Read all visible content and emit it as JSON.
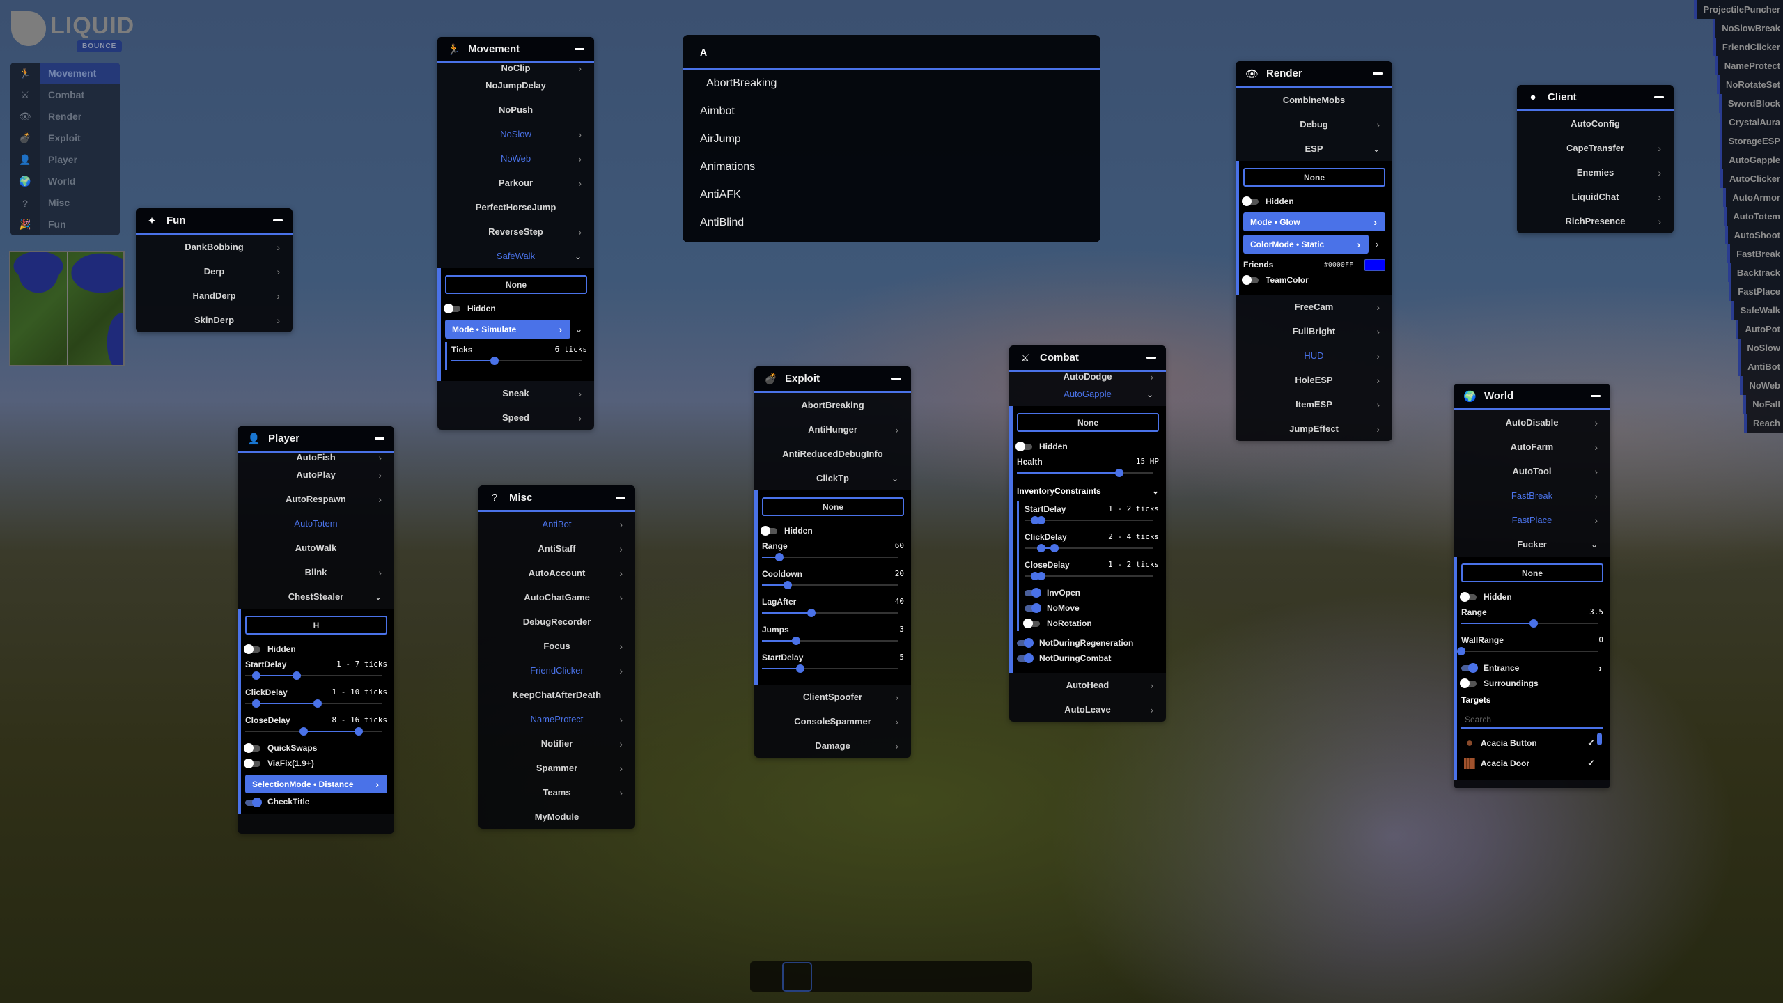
{
  "logo": {
    "word": "LIQUID",
    "badge": "BOUNCE"
  },
  "categories": [
    {
      "label": "Movement",
      "icon": "running-icon",
      "glyph": "🏃",
      "active": true
    },
    {
      "label": "Combat",
      "icon": "crossed-swords-icon",
      "glyph": "⚔"
    },
    {
      "label": "Render",
      "icon": "eye-icon",
      "glyph": "👁"
    },
    {
      "label": "Exploit",
      "icon": "bomb-icon",
      "glyph": "💣"
    },
    {
      "label": "Player",
      "icon": "user-icon",
      "glyph": "👤"
    },
    {
      "label": "World",
      "icon": "globe-icon",
      "glyph": "🌍"
    },
    {
      "label": "Misc",
      "icon": "question-icon",
      "glyph": "?"
    },
    {
      "label": "Fun",
      "icon": "party-popper-icon",
      "glyph": "🎉"
    }
  ],
  "search_popup": {
    "query": "A",
    "results": [
      "AbortBreaking",
      "Aimbot",
      "AirJump",
      "Animations",
      "AntiAFK",
      "AntiBlind"
    ]
  },
  "panels": {
    "fun": {
      "title": "Fun",
      "modules": [
        {
          "name": "DankBobbing",
          "chevron": true
        },
        {
          "name": "Derp",
          "chevron": true
        },
        {
          "name": "HandDerp",
          "chevron": true
        },
        {
          "name": "SkinDerp",
          "chevron": true
        }
      ]
    },
    "movement": {
      "title": "Movement",
      "modules_top": [
        {
          "name": "NoClip",
          "chevron": true
        },
        {
          "name": "NoJumpDelay"
        },
        {
          "name": "NoPush"
        },
        {
          "name": "NoSlow",
          "enabled": true,
          "chevron": true
        },
        {
          "name": "NoWeb",
          "enabled": true,
          "chevron": true
        },
        {
          "name": "Parkour",
          "chevron": true
        },
        {
          "name": "PerfectHorseJump"
        },
        {
          "name": "ReverseStep",
          "chevron": true
        },
        {
          "name": "SafeWalk",
          "enabled": true,
          "expanded": true
        }
      ],
      "expanded": {
        "bind": "None",
        "hidden_label": "Hidden",
        "hidden": false,
        "mode_label": "Mode • Simulate",
        "ticks": {
          "label": "Ticks",
          "value_text": "6 ticks",
          "fraction": 0.33
        }
      },
      "modules_bottom": [
        {
          "name": "Sneak",
          "chevron": true
        },
        {
          "name": "Speed",
          "chevron": true
        }
      ]
    },
    "player": {
      "title": "Player",
      "modules_top": [
        {
          "name": "AutoFish",
          "chevron": true
        },
        {
          "name": "AutoPlay",
          "chevron": true
        },
        {
          "name": "AutoRespawn",
          "chevron": true
        },
        {
          "name": "AutoTotem",
          "enabled": true
        },
        {
          "name": "AutoWalk"
        },
        {
          "name": "Blink",
          "chevron": true
        },
        {
          "name": "ChestStealer",
          "expanded": true
        }
      ],
      "expanded": {
        "bind": "H",
        "hidden_label": "Hidden",
        "start_delay": {
          "label": "StartDelay",
          "value_text": "1 - 7 ticks",
          "lo": 0.08,
          "hi": 0.38
        },
        "click_delay": {
          "label": "ClickDelay",
          "value_text": "1 - 10 ticks",
          "lo": 0.08,
          "hi": 0.53
        },
        "close_delay": {
          "label": "CloseDelay",
          "value_text": "8 - 16 ticks",
          "lo": 0.43,
          "hi": 0.83
        },
        "quick_swaps": "QuickSwaps",
        "via_fix": "ViaFix(1.9+)",
        "selection_mode": "SelectionMode • Distance",
        "check_title": "CheckTitle"
      }
    },
    "misc": {
      "title": "Misc",
      "modules": [
        {
          "name": "AntiBot",
          "enabled": true,
          "chevron": true
        },
        {
          "name": "AntiStaff",
          "chevron": true
        },
        {
          "name": "AutoAccount",
          "chevron": true
        },
        {
          "name": "AutoChatGame",
          "chevron": true
        },
        {
          "name": "DebugRecorder"
        },
        {
          "name": "Focus",
          "chevron": true
        },
        {
          "name": "FriendClicker",
          "enabled": true,
          "chevron": true
        },
        {
          "name": "KeepChatAfterDeath"
        },
        {
          "name": "NameProtect",
          "enabled": true,
          "chevron": true
        },
        {
          "name": "Notifier",
          "chevron": true
        },
        {
          "name": "Spammer",
          "chevron": true
        },
        {
          "name": "Teams",
          "chevron": true
        },
        {
          "name": "MyModule"
        }
      ]
    },
    "exploit": {
      "title": "Exploit",
      "modules_top": [
        {
          "name": "AbortBreaking"
        },
        {
          "name": "AntiHunger",
          "chevron": true
        },
        {
          "name": "AntiReducedDebugInfo"
        },
        {
          "name": "ClickTp",
          "expanded": true
        }
      ],
      "expanded": {
        "bind": "None",
        "hidden_label": "Hidden",
        "sliders": [
          {
            "label": "Range",
            "value_text": "60",
            "fraction": 0.13
          },
          {
            "label": "Cooldown",
            "value_text": "20",
            "fraction": 0.19
          },
          {
            "label": "LagAfter",
            "value_text": "40",
            "fraction": 0.36
          },
          {
            "label": "Jumps",
            "value_text": "3",
            "fraction": 0.25
          },
          {
            "label": "StartDelay",
            "value_text": "5",
            "fraction": 0.28
          }
        ]
      },
      "modules_bottom": [
        {
          "name": "ClientSpoofer",
          "chevron": true
        },
        {
          "name": "ConsoleSpammer",
          "chevron": true
        },
        {
          "name": "Damage",
          "chevron": true
        }
      ]
    },
    "combat": {
      "title": "Combat",
      "modules_top": [
        {
          "name": "AutoDodge",
          "chevron": true
        },
        {
          "name": "AutoGapple",
          "enabled": true,
          "expanded": true
        }
      ],
      "expanded": {
        "bind": "None",
        "hidden_label": "Hidden",
        "health": {
          "label": "Health",
          "value_text": "15 HP",
          "fraction": 0.75
        },
        "inventory_constraints": "InventoryConstraints",
        "start_delay": {
          "label": "StartDelay",
          "value_text": "1 - 2 ticks",
          "lo": 0.08,
          "hi": 0.13
        },
        "click_delay": {
          "label": "ClickDelay",
          "value_text": "2 - 4 ticks",
          "lo": 0.13,
          "hi": 0.23
        },
        "close_delay": {
          "label": "CloseDelay",
          "value_text": "1 - 2 ticks",
          "lo": 0.08,
          "hi": 0.13
        },
        "inv_open": "InvOpen",
        "no_move": "NoMove",
        "no_rotation": "NoRotation",
        "not_during_regeneration": "NotDuringRegeneration",
        "not_during_combat": "NotDuringCombat"
      },
      "modules_bottom": [
        {
          "name": "AutoHead",
          "chevron": true
        },
        {
          "name": "AutoLeave",
          "chevron": true
        }
      ]
    },
    "render": {
      "title": "Render",
      "modules_top": [
        {
          "name": "CombineMobs"
        },
        {
          "name": "Debug",
          "chevron": true
        },
        {
          "name": "ESP",
          "expanded": true
        }
      ],
      "expanded": {
        "bind": "None",
        "hidden_label": "Hidden",
        "mode_label": "Mode • Glow",
        "color_mode_label": "ColorMode • Static",
        "friends_label": "Friends",
        "friends_hex": "#0000FF",
        "friends_color": "#0000ff",
        "team_color": "TeamColor"
      },
      "modules_bottom": [
        {
          "name": "FreeCam",
          "chevron": true
        },
        {
          "name": "FullBright",
          "chevron": true
        },
        {
          "name": "HUD",
          "enabled": true,
          "chevron": true
        },
        {
          "name": "HoleESP",
          "chevron": true
        },
        {
          "name": "ItemESP",
          "chevron": true
        },
        {
          "name": "JumpEffect",
          "chevron": true
        }
      ]
    },
    "client": {
      "title": "Client",
      "modules": [
        {
          "name": "AutoConfig"
        },
        {
          "name": "CapeTransfer",
          "chevron": true
        },
        {
          "name": "Enemies",
          "chevron": true
        },
        {
          "name": "LiquidChat",
          "chevron": true
        },
        {
          "name": "RichPresence",
          "chevron": true
        }
      ]
    },
    "world": {
      "title": "World",
      "modules_top": [
        {
          "name": "AutoDisable",
          "chevron": true
        },
        {
          "name": "AutoFarm",
          "chevron": true
        },
        {
          "name": "AutoTool",
          "chevron": true
        },
        {
          "name": "FastBreak",
          "enabled": true,
          "chevron": true
        },
        {
          "name": "FastPlace",
          "enabled": true,
          "chevron": true
        },
        {
          "name": "Fucker",
          "expanded": true
        }
      ],
      "expanded": {
        "bind": "None",
        "hidden_label": "Hidden",
        "range": {
          "label": "Range",
          "value_text": "3.5",
          "fraction": 0.53
        },
        "wall_range": {
          "label": "WallRange",
          "value_text": "0",
          "fraction": 0.0
        },
        "entrance": "Entrance",
        "surroundings": "Surroundings",
        "targets_label": "Targets",
        "search_placeholder": "Search",
        "targets": [
          {
            "name": "Acacia Button",
            "checked": true
          },
          {
            "name": "Acacia Door",
            "checked": true
          }
        ]
      }
    }
  },
  "arraylist": [
    "ProjectilePuncher",
    "NoSlowBreak",
    "FriendClicker",
    "NameProtect",
    "NoRotateSet",
    "SwordBlock",
    "CrystalAura",
    "StorageESP",
    "AutoGapple",
    "AutoClicker",
    "AutoArmor",
    "AutoTotem",
    "AutoShoot",
    "FastBreak",
    "Backtrack",
    "FastPlace",
    "SafeWalk",
    "AutoPot",
    "NoSlow",
    "AntiBot",
    "NoWeb",
    "NoFall",
    "Reach"
  ],
  "colors": {
    "accent": "#4a72e8",
    "arraylist_bar": "#2a3c90"
  }
}
